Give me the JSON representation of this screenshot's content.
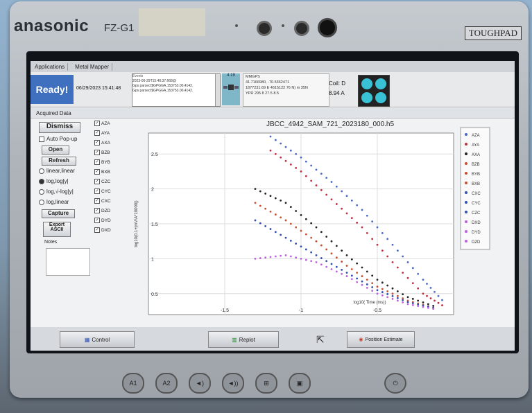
{
  "device": {
    "brand": "anasonic",
    "model": "FZ-G1",
    "toughpad": "TOUGHPAD"
  },
  "tabs": [
    "Applications",
    "Metal Mapper"
  ],
  "topbar": {
    "status": "Ready!",
    "datetime": "06/29/2023 15:41:48",
    "events_header": "Events",
    "events": [
      "2023-06-29T15:40:37.668@",
      "Gps parsed:$GPGGA,153753.00,4142.",
      "Gps parsed:$GPGGA,153753.00,4142."
    ],
    "gps_header": "MMGPS",
    "gps_lines": [
      "41.7166980, -70.5362471",
      "1877231.69 E 4615122 76 N) m 35N",
      "YPR 295 8 27.5 8.5"
    ],
    "gps_value": "4.19",
    "coil_label": "Coil: D",
    "coil_value": "8.94 A"
  },
  "acquired_title": "Acquired Data",
  "sidebar": {
    "dismiss": "Dismiss",
    "auto_popup": "Auto Pop-up",
    "open": "Open",
    "refresh": "Refresh",
    "radios": [
      "linear,linear",
      "log,log|y|",
      "log,√-log|y|",
      "log,linear"
    ],
    "capture": "Capture",
    "export": "Export ASCII",
    "notes": "Notes"
  },
  "channels": [
    "AZA",
    "AYA",
    "AXA",
    "BZB",
    "BYB",
    "BXB",
    "CZC",
    "CYC",
    "CXC",
    "DZD",
    "DYD",
    "DXD"
  ],
  "legend": [
    "AZA",
    "AYA",
    "AXA",
    "BZB",
    "BYB",
    "BXB",
    "CXC",
    "CYC",
    "CZC",
    "DXD",
    "DYD",
    "DZD"
  ],
  "chart_data": {
    "type": "scatter",
    "title": "JBCC_4942_SAM_721_2023180_000.h5",
    "xlabel": "log10( Time (ms))",
    "ylabel": "log10(0.1+|mV/A*10000|)",
    "xticks": [
      "-1.5",
      "-1",
      "-0.5"
    ],
    "yticks": [
      "2.5",
      "2",
      "1.5",
      "1",
      "0.5"
    ],
    "xlim": [
      -2.0,
      0.0
    ],
    "ylim": [
      0.2,
      2.8
    ],
    "series": [
      {
        "name": "AZA",
        "color": "#4a68c8",
        "x": [
          -1.2,
          -1.0,
          -0.8,
          -0.6,
          -0.4,
          -0.2,
          -0.05
        ],
        "y": [
          2.75,
          2.45,
          2.1,
          1.7,
          1.2,
          0.7,
          0.35
        ]
      },
      {
        "name": "AYA",
        "color": "#c03040",
        "x": [
          -1.2,
          -1.0,
          -0.8,
          -0.6,
          -0.4,
          -0.2,
          -0.05
        ],
        "y": [
          2.55,
          2.25,
          1.85,
          1.45,
          0.95,
          0.5,
          0.3
        ]
      },
      {
        "name": "AXA",
        "color": "#222222",
        "x": [
          -1.3,
          -1.1,
          -0.9,
          -0.7,
          -0.5,
          -0.3,
          -0.1
        ],
        "y": [
          2.0,
          1.8,
          1.45,
          1.05,
          0.7,
          0.45,
          0.3
        ]
      },
      {
        "name": "BZB",
        "color": "#c85030",
        "x": [
          -1.3,
          -1.1,
          -0.9,
          -0.7,
          -0.5,
          -0.3,
          -0.1
        ],
        "y": [
          1.8,
          1.55,
          1.25,
          0.9,
          0.6,
          0.4,
          0.28
        ]
      },
      {
        "name": "CZC",
        "color": "#3050b0",
        "x": [
          -1.3,
          -1.1,
          -0.9,
          -0.7,
          -0.5,
          -0.3,
          -0.1
        ],
        "y": [
          1.55,
          1.3,
          1.05,
          0.8,
          0.55,
          0.38,
          0.28
        ]
      },
      {
        "name": "DZD",
        "color": "#c060e0",
        "x": [
          -1.3,
          -1.1,
          -0.9,
          -0.7,
          -0.5,
          -0.3,
          -0.1
        ],
        "y": [
          1.0,
          1.05,
          0.95,
          0.75,
          0.5,
          0.35,
          0.27
        ]
      }
    ]
  },
  "bottombar": {
    "control": "Control",
    "replot": "Replot",
    "position_estimate": "Position Estimate"
  },
  "hardware": [
    "A1",
    "A2"
  ]
}
